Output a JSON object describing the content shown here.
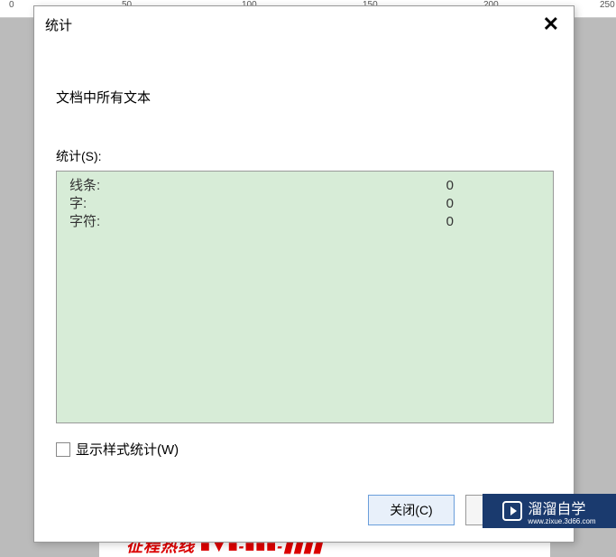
{
  "ruler": {
    "marks": [
      "0",
      "50",
      "100",
      "150",
      "200",
      "250"
    ]
  },
  "dialog": {
    "title": "统计",
    "section_title": "文档中所有文本",
    "stats_label": "统计(S):",
    "stats": [
      {
        "label": "线条:",
        "value": "0"
      },
      {
        "label": "字:",
        "value": "0"
      },
      {
        "label": "字符:",
        "value": "0"
      }
    ],
    "checkbox_label": "显示样式统计(W)",
    "close_button": "关闭(C)"
  },
  "watermark": {
    "text": "溜溜自学",
    "sub": "www.zixue.3d66.com"
  },
  "background_text": "征程热线 ■▼■-■■■-▮▮▮▮"
}
